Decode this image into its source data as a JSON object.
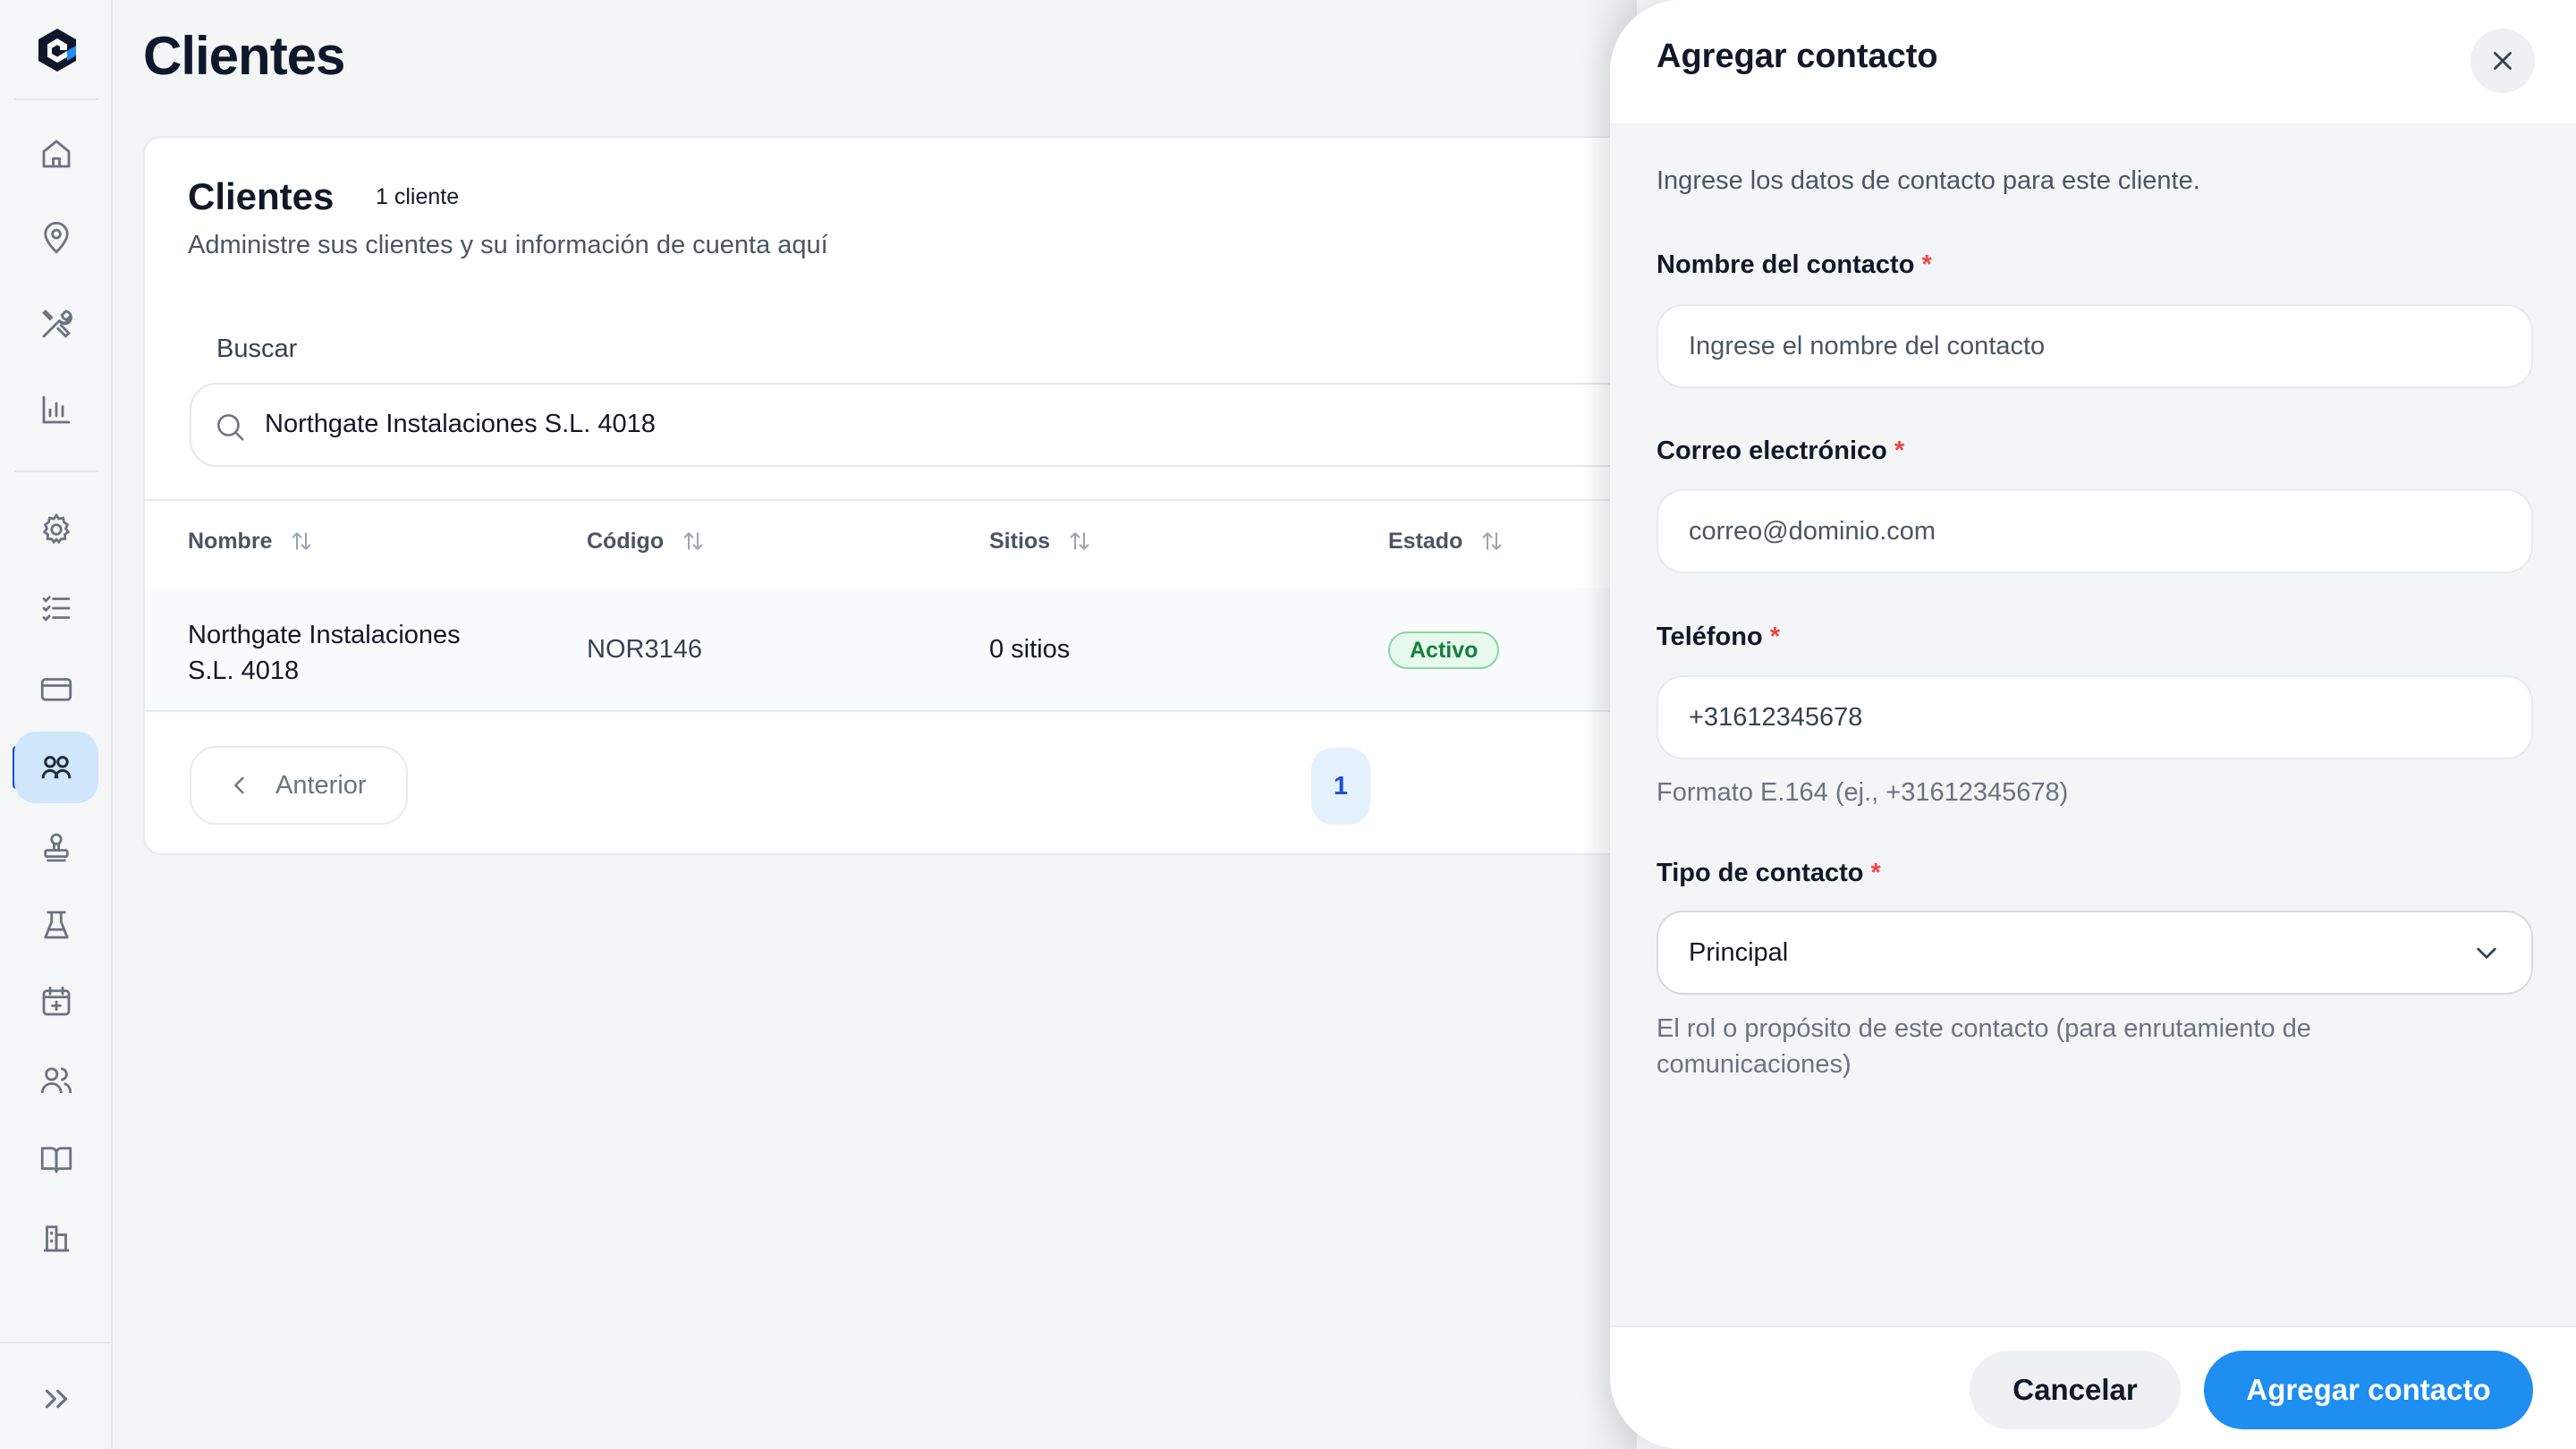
{
  "colors": {
    "accent": "#1e8ef0",
    "active_nav": "#cfe6fb",
    "status_active": "#15803d",
    "required": "#ef4444"
  },
  "sidebar": {
    "logo": "app-logo",
    "items": [
      {
        "icon": "home-icon",
        "active": false
      },
      {
        "icon": "map-pin-icon",
        "active": false
      },
      {
        "icon": "tools-icon",
        "active": false
      },
      {
        "icon": "bar-chart-icon",
        "active": false
      },
      {
        "icon": "settings-icon",
        "active": false
      },
      {
        "icon": "checklist-icon",
        "active": false
      },
      {
        "icon": "credit-card-icon",
        "active": false
      },
      {
        "icon": "clients-icon",
        "active": true
      },
      {
        "icon": "stamp-icon",
        "active": false
      },
      {
        "icon": "flask-icon",
        "active": false
      },
      {
        "icon": "calendar-add-icon",
        "active": false
      },
      {
        "icon": "users-icon",
        "active": false
      },
      {
        "icon": "book-icon",
        "active": false
      },
      {
        "icon": "buildings-icon",
        "active": false
      }
    ],
    "expand_icon": "chevrons-right-icon"
  },
  "page": {
    "title": "Clientes"
  },
  "card": {
    "title": "Clientes",
    "count_badge": "1 cliente",
    "subtitle": "Administre sus clientes y su información de cuenta aquí",
    "search_label": "Buscar",
    "search_value": "Northgate Instalaciones S.L. 4018"
  },
  "table": {
    "columns": [
      "Nombre",
      "Código",
      "Sitios",
      "Estado"
    ],
    "rows": [
      {
        "name_line1": "Northgate Instalaciones",
        "name_line2": "S.L. 4018",
        "code": "NOR3146",
        "sites": "0 sitios",
        "status": "Activo"
      }
    ]
  },
  "pagination": {
    "prev_label": "Anterior",
    "current_page": "1"
  },
  "drawer": {
    "title": "Agregar contacto",
    "description": "Ingrese los datos de contacto para este cliente.",
    "required_mark": "*",
    "fields": {
      "name": {
        "label": "Nombre del contacto",
        "placeholder": "Ingrese el nombre del contacto"
      },
      "email": {
        "label": "Correo electrónico",
        "placeholder": "correo@dominio.com"
      },
      "phone": {
        "label": "Teléfono",
        "value": "+31612345678",
        "hint": "Formato E.164 (ej., +31612345678)"
      },
      "type": {
        "label": "Tipo de contacto",
        "selected": "Principal",
        "hint": "El rol o propósito de este contacto (para enrutamiento de comunicaciones)"
      }
    },
    "cancel_label": "Cancelar",
    "submit_label": "Agregar contacto"
  }
}
